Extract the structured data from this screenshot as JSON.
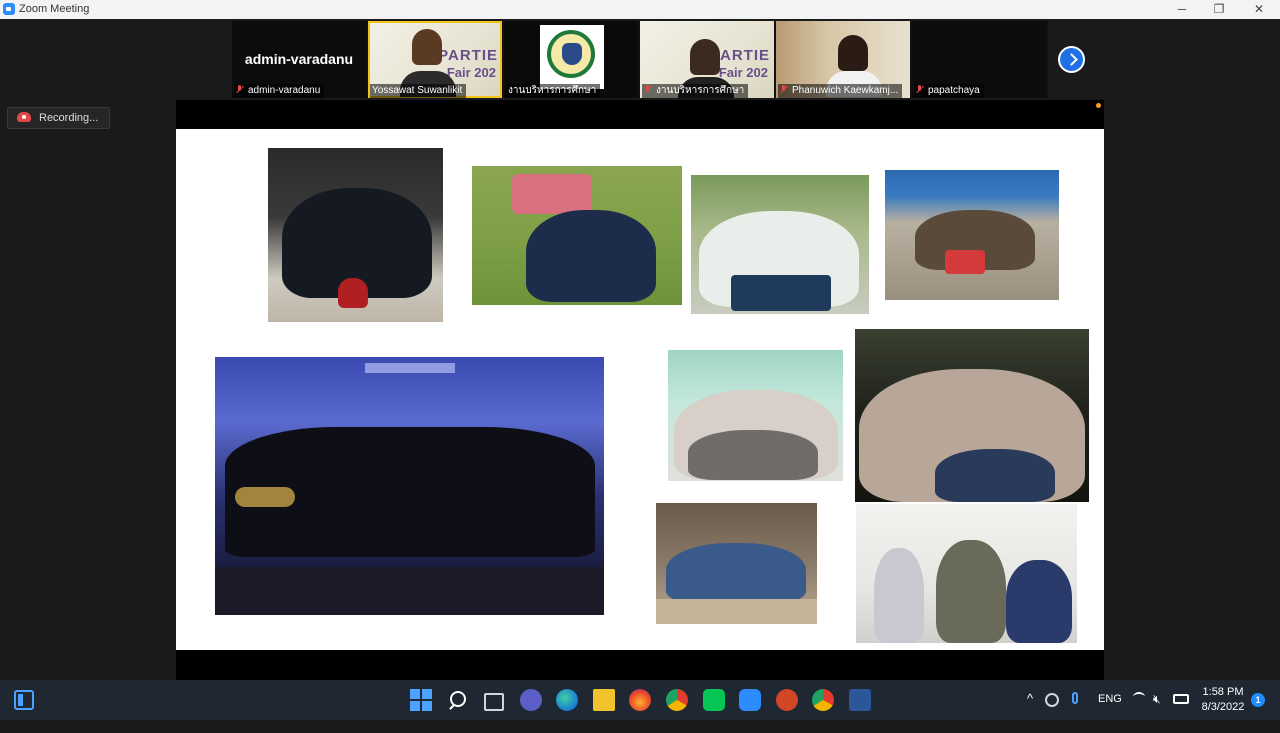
{
  "window": {
    "title": "Zoom Meeting",
    "minimize_glyph": "─",
    "maximize_glyph": "❐",
    "close_glyph": "✕"
  },
  "recording": {
    "label": "Recording..."
  },
  "participants": [
    {
      "name": "admin-varadanu",
      "display": "admin-varadanu",
      "muted": true,
      "video": false
    },
    {
      "name": "Yossawat Suwanlikit",
      "muted": false,
      "video": true,
      "active_speaker": true
    },
    {
      "name": "งานบริหารการศึกษา",
      "muted": false,
      "video": true
    },
    {
      "name": "งานบริหารการศึกษา",
      "muted": true,
      "video": true
    },
    {
      "name": "Phanuwich Kaewkamj...",
      "muted": true,
      "video": true
    },
    {
      "name": "papatchaya",
      "muted": true,
      "video": false
    }
  ],
  "poster_text": {
    "line1": "PARTIE",
    "line2": "Fair 202"
  },
  "taskbar": {
    "language": "ENG",
    "time": "1:58 PM",
    "date": "8/3/2022",
    "notification_count": "1",
    "tray_chevron": "^"
  },
  "colors": {
    "zoom_blue": "#2d8cff",
    "muted_red": "#e04848",
    "recording_red": "#e04848",
    "active_speaker_outline": "#f0c419",
    "taskbar_bg": "#1f2733"
  }
}
